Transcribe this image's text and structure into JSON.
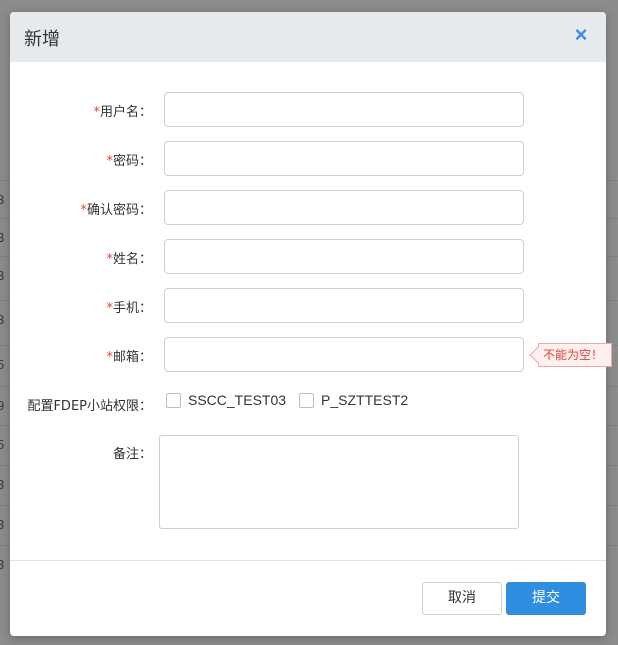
{
  "background": {
    "row_fragments": [
      "3",
      "3",
      "3",
      "3",
      "5",
      "9",
      "5",
      "3",
      "3",
      "3"
    ]
  },
  "dialog": {
    "title": "新增",
    "close_icon": "close-icon"
  },
  "form": {
    "required_mark": "*",
    "username_label": "用户名：",
    "password_label": "密码：",
    "confirm_password_label": "确认密码：",
    "name_label": "姓名：",
    "phone_label": "手机：",
    "email_label": "邮箱：",
    "email_error": "不能为空！",
    "fdep_label": "配置FDEP小站权限：",
    "fdep_options": [
      "SSCC_TEST03",
      "P_SZTTEST2"
    ],
    "remark_label": "备注："
  },
  "footer": {
    "cancel_label": "取消",
    "submit_label": "提交"
  },
  "colors": {
    "accent": "#2f8ee0",
    "error": "#e0463b",
    "header_bg": "#e7eaed"
  }
}
